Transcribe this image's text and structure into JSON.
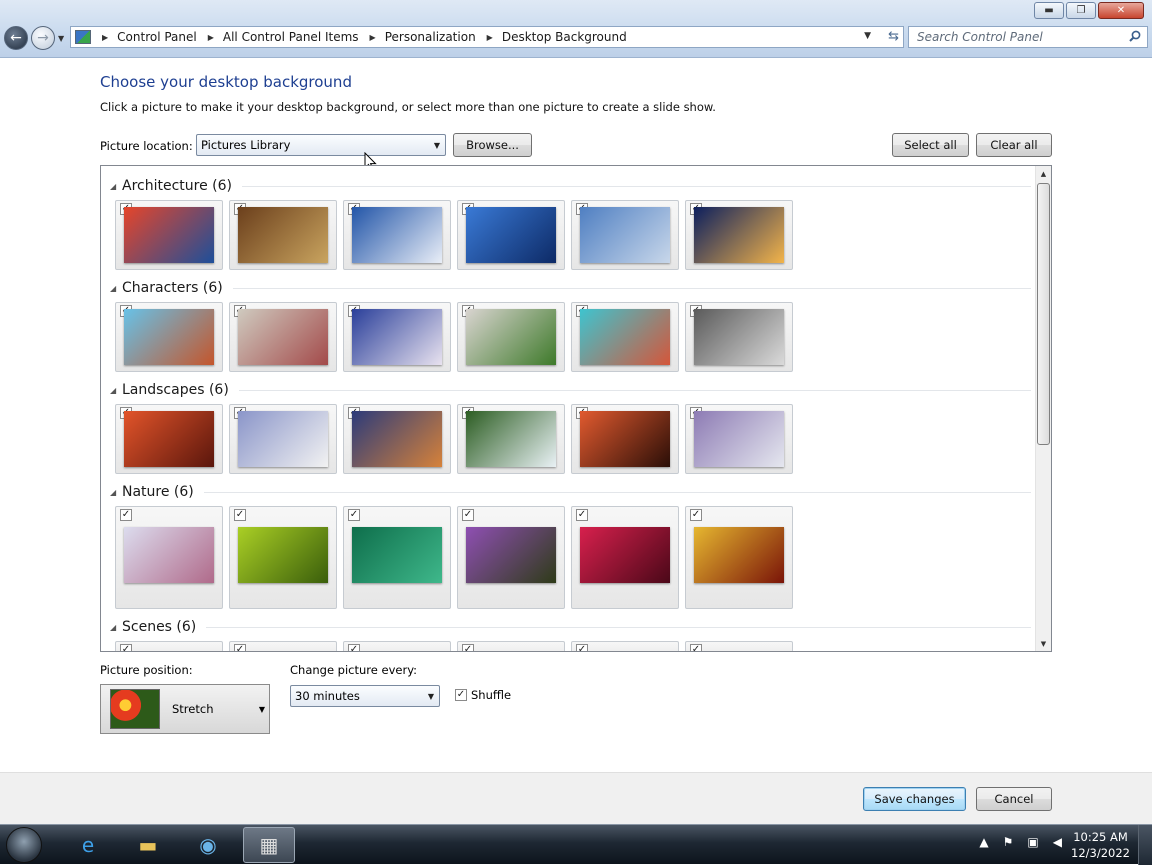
{
  "window": {
    "min_glyph": "▬",
    "max_glyph": "❐",
    "close_glyph": "✕"
  },
  "address": {
    "breadcrumbs": [
      "Control Panel",
      "All Control Panel Items",
      "Personalization",
      "Desktop Background"
    ],
    "search_placeholder": "Search Control Panel"
  },
  "page": {
    "heading": "Choose your desktop background",
    "subheading": "Click a picture to make it your desktop background, or select more than one picture to create a slide show.",
    "location_label": "Picture location:",
    "location_value": "Pictures Library",
    "browse_label": "Browse...",
    "select_all_label": "Select all",
    "clear_all_label": "Clear all"
  },
  "groups": [
    {
      "label": "Architecture (6)",
      "colors": [
        [
          "#e6452a",
          "#1d4f9a"
        ],
        [
          "#6b3f1c",
          "#c9a45f"
        ],
        [
          "#2255a8",
          "#e9eef7"
        ],
        [
          "#3a7ad6",
          "#0d2a66"
        ],
        [
          "#4f7fc2",
          "#c8d7ea"
        ],
        [
          "#0c1f5e",
          "#f3b44a"
        ]
      ]
    },
    {
      "label": "Characters (6)",
      "colors": [
        [
          "#67c2e8",
          "#c4552b"
        ],
        [
          "#cfcabf",
          "#a34a4a"
        ],
        [
          "#2a3f9a",
          "#e8e2ef"
        ],
        [
          "#d9d4d0",
          "#3e7a2a"
        ],
        [
          "#3ec4cf",
          "#d4563a"
        ],
        [
          "#5a5a5a",
          "#dadada"
        ]
      ]
    },
    {
      "label": "Landscapes (6)",
      "colors": [
        [
          "#e2542a",
          "#5a160c"
        ],
        [
          "#8a95c9",
          "#f2f2f2"
        ],
        [
          "#2c3b7a",
          "#d6823a"
        ],
        [
          "#2c5d22",
          "#e9f1f5"
        ],
        [
          "#e15a2f",
          "#2a0e07"
        ],
        [
          "#8d7bb4",
          "#e5e7ef"
        ]
      ]
    },
    {
      "label": "Nature (6)",
      "colors": [
        [
          "#dcdcee",
          "#b06a8a"
        ],
        [
          "#aacf25",
          "#3a5e0b"
        ],
        [
          "#0e6e4b",
          "#3fb88b"
        ],
        [
          "#8f4fb3",
          "#2e3b18"
        ],
        [
          "#d7204d",
          "#4a0818"
        ],
        [
          "#e6b730",
          "#7a1408"
        ]
      ]
    },
    {
      "label": "Scenes (6)",
      "colors": []
    }
  ],
  "options": {
    "position_label": "Picture position:",
    "position_value": "Stretch",
    "interval_label": "Change picture every:",
    "interval_value": "30 minutes",
    "shuffle_label": "Shuffle"
  },
  "footer": {
    "save_label": "Save changes",
    "cancel_label": "Cancel"
  },
  "taskbar": {
    "time": "10:25 AM",
    "date": "12/3/2022"
  }
}
